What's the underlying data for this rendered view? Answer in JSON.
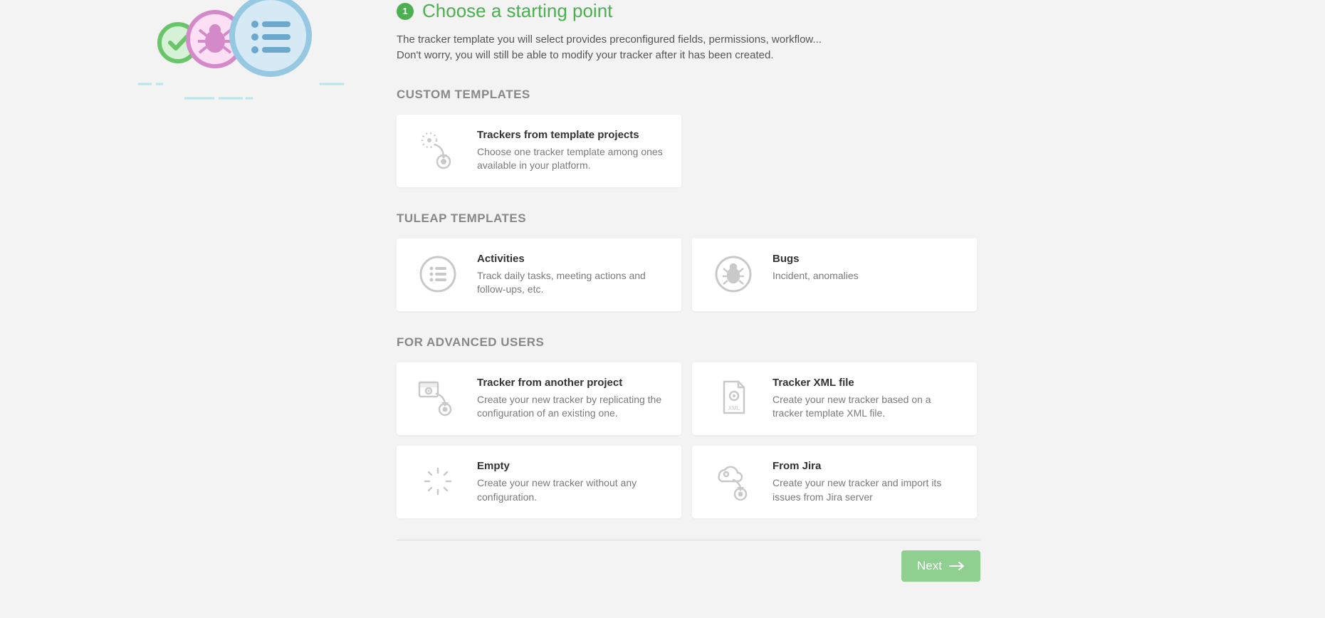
{
  "step": {
    "number": "1",
    "title": "Choose a starting point"
  },
  "intro": {
    "line1": "The tracker template you will select provides preconfigured fields, permissions, workflow...",
    "line2": "Don't worry, you will still be able to modify your tracker after it has been created."
  },
  "sections": {
    "custom": {
      "heading": "CUSTOM TEMPLATES",
      "cards": [
        {
          "title": "Trackers from template projects",
          "desc": "Choose one tracker template among ones available in your platform."
        }
      ]
    },
    "tuleap": {
      "heading": "TULEAP TEMPLATES",
      "cards": [
        {
          "title": "Activities",
          "desc": "Track daily tasks, meeting actions and follow-ups, etc."
        },
        {
          "title": "Bugs",
          "desc": "Incident, anomalies"
        }
      ]
    },
    "advanced": {
      "heading": "FOR ADVANCED USERS",
      "cards": [
        {
          "title": "Tracker from another project",
          "desc": "Create your new tracker by replicating the configuration of an existing one."
        },
        {
          "title": "Tracker XML file",
          "desc": "Create your new tracker based on a tracker template XML file."
        },
        {
          "title": "Empty",
          "desc": "Create your new tracker without any configuration."
        },
        {
          "title": "From Jira",
          "desc": "Create your new tracker and import its issues from Jira server"
        }
      ]
    }
  },
  "footer": {
    "next_label": "Next"
  },
  "colors": {
    "accent": "#4caf50",
    "card_bg": "#ffffff",
    "page_bg": "#f3f3f3",
    "muted": "#7a7a7a"
  }
}
